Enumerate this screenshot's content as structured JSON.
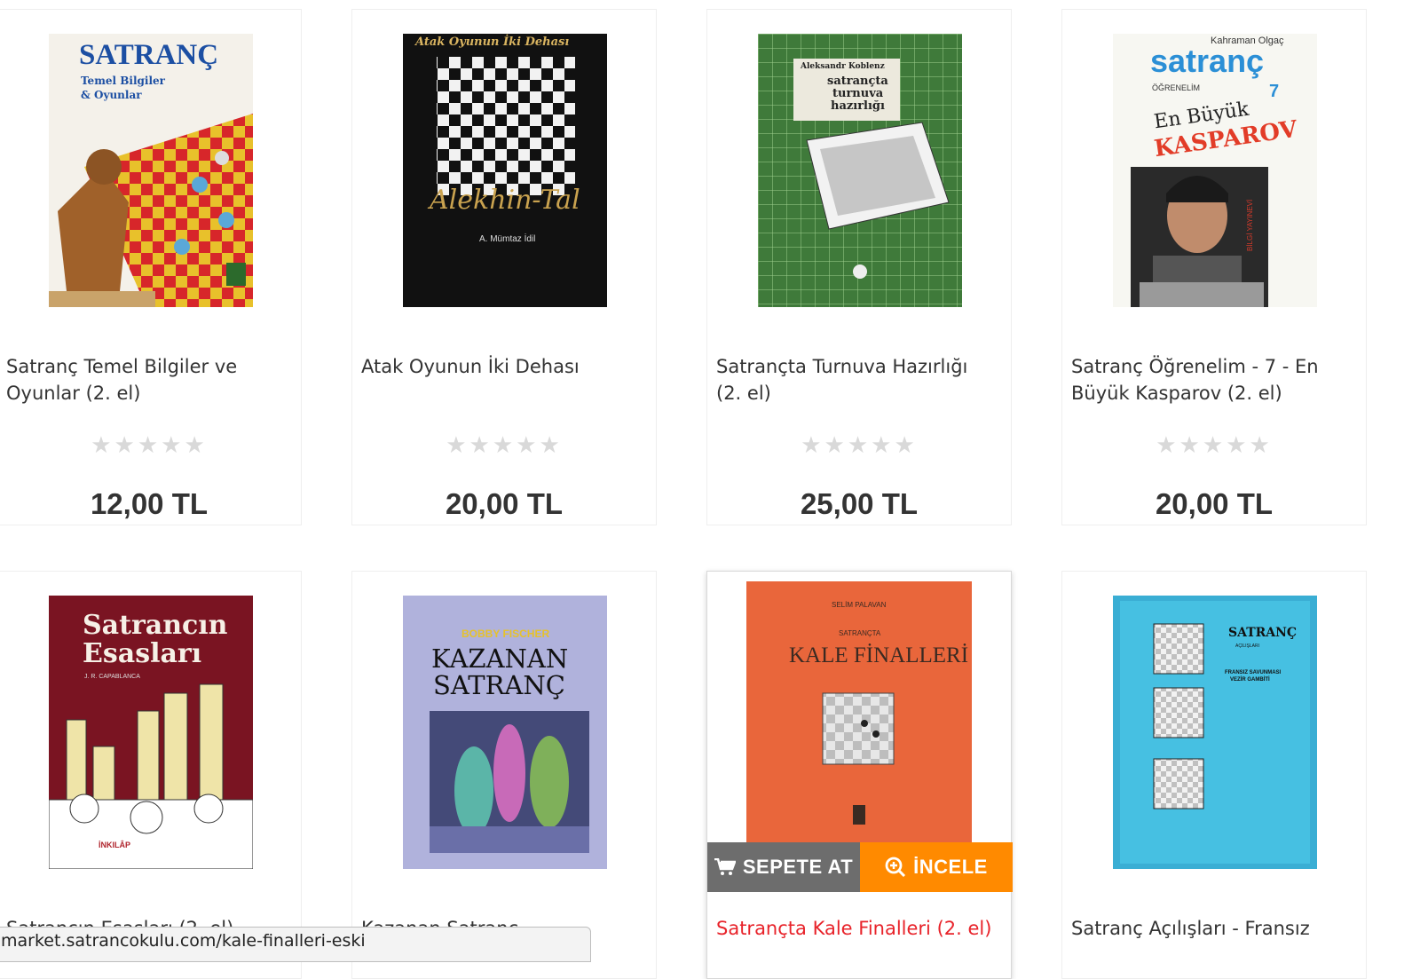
{
  "products": [
    {
      "name": "Satranç Temel Bilgiler ve Oyunlar (2. el)",
      "price": "12,00 TL",
      "rating": 0,
      "cover_lines": [
        "SATRANÇ",
        "Temel Bilgiler",
        "& Oyunlar"
      ]
    },
    {
      "name": "Atak Oyunun İki Dehası",
      "price": "20,00 TL",
      "rating": 0,
      "cover_lines": [
        "Atak Oyunun İki Dehası",
        "Alekhin-Tal",
        "A. Mümtaz İdil"
      ]
    },
    {
      "name": "Satrançta Turnuva Hazırlığı (2. el)",
      "price": "25,00 TL",
      "rating": 0,
      "cover_lines": [
        "Aleksandr Koblenz",
        "satrançta",
        "turnuva",
        "hazırlığı"
      ]
    },
    {
      "name": "Satranç Öğrenelim - 7 - En Büyük Kasparov (2. el)",
      "price": "20,00 TL",
      "rating": 0,
      "cover_lines": [
        "Kahraman Olgaç",
        "satranç",
        "ÖĞRENELİM",
        "7",
        "En Büyük",
        "KASPAROV",
        "BİLGİ YAYINEVİ"
      ]
    },
    {
      "name": "Satrancın Esasları (2. el)",
      "cover_lines": [
        "Satrancın",
        "Esasları",
        "J. R. CAPABLANCA",
        "İNKILÂP"
      ]
    },
    {
      "name": "Kazanan Satranç",
      "cover_lines": [
        "BOBBY FISCHER",
        "KAZANAN",
        "SATRANÇ"
      ]
    },
    {
      "name": "Satrançta Kale Finalleri (2. el)",
      "cover_lines": [
        "SELİM PALAVAN",
        "SATRANÇTA",
        "KALE FİNALLERİ"
      ]
    },
    {
      "name": "Satranç Açılışları - Fransız",
      "cover_lines": [
        "SATRANÇ",
        "AÇILIŞLARI",
        "FRANSIZ SAVUNMASI",
        "VEZİR GAMBİTİ"
      ]
    }
  ],
  "buttons": {
    "add_to_cart": "SEPETE AT",
    "inspect": "İNCELE"
  },
  "status_url": "market.satrancokulu.com/kale-finalleri-eski",
  "colors": {
    "title_active": "#e8232a",
    "cart_button": "#6d6d6d",
    "inspect_button": "#ff8a00"
  }
}
